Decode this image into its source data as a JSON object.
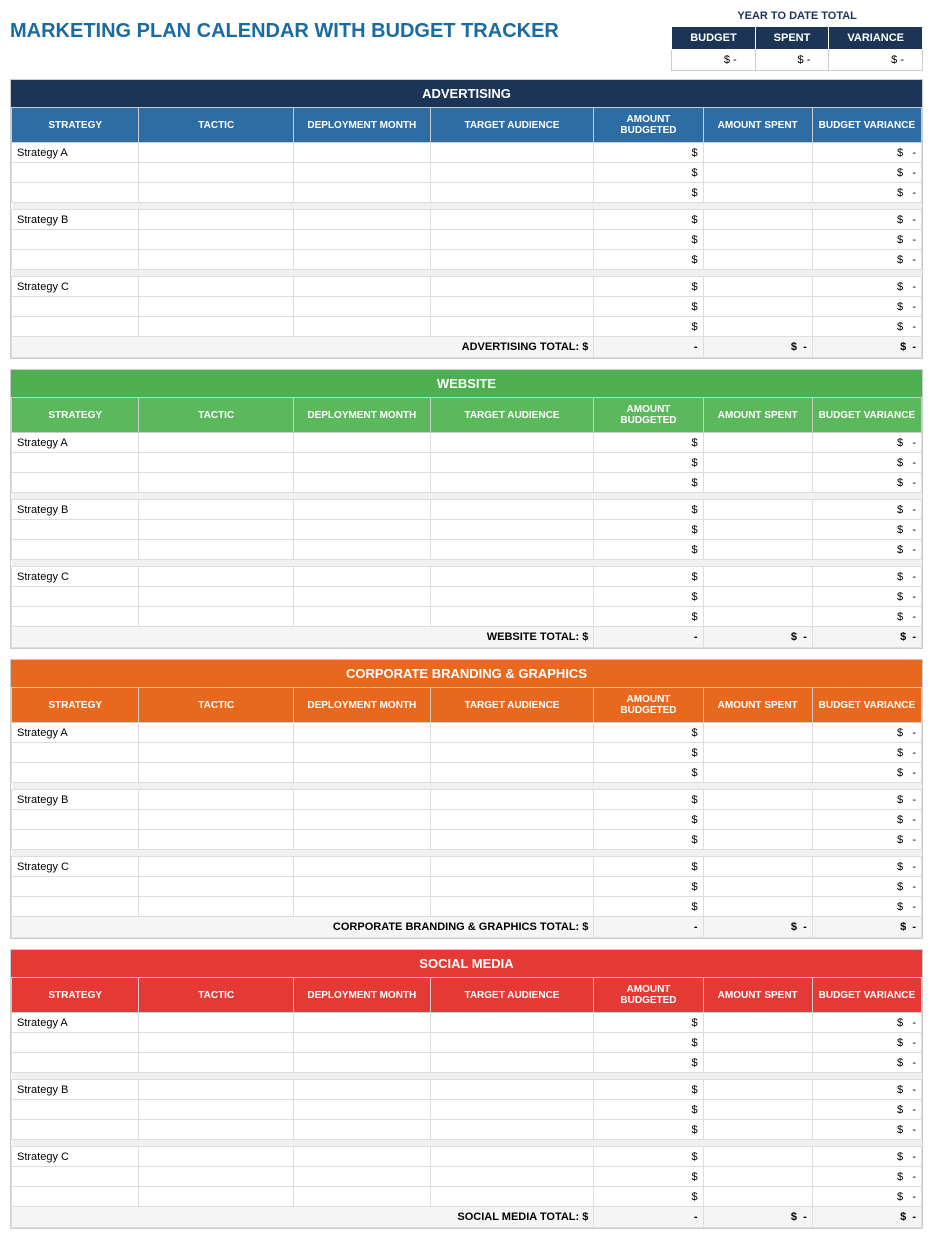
{
  "title": "MARKETING PLAN CALENDAR WITH BUDGET TRACKER",
  "ytd": {
    "label": "YEAR TO DATE TOTAL",
    "columns": [
      "BUDGET",
      "SPENT",
      "VARIANCE"
    ],
    "values": [
      "$ -",
      "$ -",
      "$ -"
    ]
  },
  "sections": [
    {
      "id": "advertising",
      "name": "ADVERTISING",
      "colorClass": "section-advertising",
      "total_label": "ADVERTISING TOTAL:",
      "strategies": [
        "Strategy A",
        "Strategy B",
        "Strategy C"
      ],
      "rows_per_strategy": 3
    },
    {
      "id": "website",
      "name": "WEBSITE",
      "colorClass": "section-website",
      "total_label": "WEBSITE TOTAL:",
      "strategies": [
        "Strategy A",
        "Strategy B",
        "Strategy C"
      ],
      "rows_per_strategy": 3
    },
    {
      "id": "branding",
      "name": "CORPORATE BRANDING & GRAPHICS",
      "colorClass": "section-branding",
      "total_label": "CORPORATE BRANDING & GRAPHICS TOTAL:",
      "strategies": [
        "Strategy A",
        "Strategy B",
        "Strategy C"
      ],
      "rows_per_strategy": 3
    },
    {
      "id": "social",
      "name": "SOCIAL MEDIA",
      "colorClass": "section-social",
      "total_label": "SOCIAL MEDIA TOTAL:",
      "strategies": [
        "Strategy A",
        "Strategy B",
        "Strategy C"
      ],
      "rows_per_strategy": 3
    }
  ],
  "col_headers": {
    "strategy": "STRATEGY",
    "tactic": "TACTIC",
    "deployment": "DEPLOYMENT MONTH",
    "target": "TARGET AUDIENCE",
    "budgeted": "AMOUNT BUDGETED",
    "spent": "AMOUNT SPENT",
    "variance": "BUDGET VARIANCE"
  }
}
